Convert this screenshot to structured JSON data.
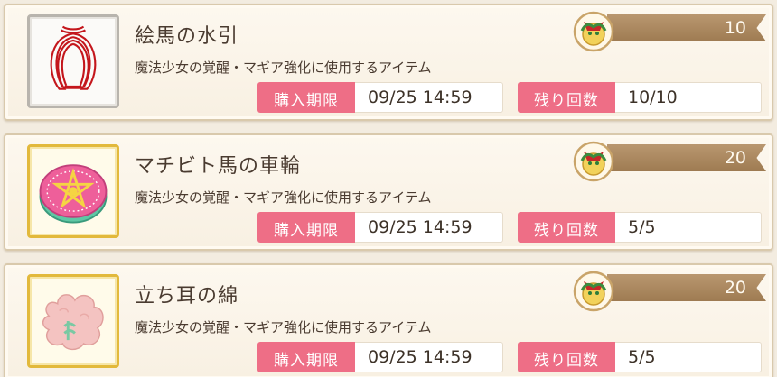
{
  "items": [
    {
      "name": "絵馬の水引",
      "description": "魔法少女の覚醒・マギア強化に使用するアイテム",
      "price": "10",
      "deadline_label": "購入期限",
      "deadline": "09/25 14:59",
      "remaining_label": "残り回数",
      "remaining": "10/10",
      "icon": "red-cord-icon",
      "frame": "silver"
    },
    {
      "name": "マチビト馬の車輪",
      "description": "魔法少女の覚醒・マギア強化に使用するアイテム",
      "price": "20",
      "deadline_label": "購入期限",
      "deadline": "09/25 14:59",
      "remaining_label": "残り回数",
      "remaining": "5/5",
      "icon": "pink-wheel-icon",
      "frame": "gold"
    },
    {
      "name": "立ち耳の綿",
      "description": "魔法少女の覚醒・マギア強化に使用するアイテム",
      "price": "20",
      "deadline_label": "購入期限",
      "deadline": "09/25 14:59",
      "remaining_label": "残り回数",
      "remaining": "5/5",
      "icon": "cotton-icon",
      "frame": "gold"
    }
  ],
  "currency_icon": "gift-coin-icon",
  "colors": {
    "label_pink": "#ee6e86",
    "price_bar": "#a8845a",
    "text": "#4a3b30",
    "gold_frame": "#e2b93c",
    "silver_frame": "#b8b4ad"
  }
}
